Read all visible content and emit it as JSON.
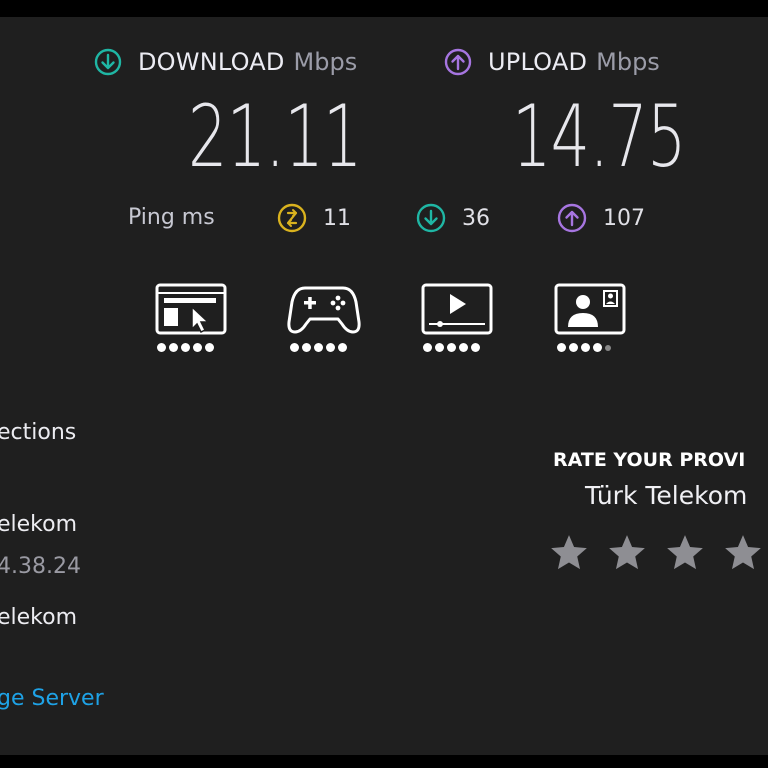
{
  "download": {
    "label": "DOWNLOAD",
    "unit": "Mbps",
    "value": "21.11",
    "color": "#1fb6a4"
  },
  "upload": {
    "label": "UPLOAD",
    "unit": "Mbps",
    "value": "14.75",
    "color": "#a675e0"
  },
  "ping": {
    "label": "Ping ms",
    "idle": {
      "value": "11",
      "color": "#d9b21e"
    },
    "down": {
      "value": "36",
      "color": "#1fb6a4"
    },
    "up": {
      "value": "107",
      "color": "#a675e0"
    }
  },
  "quality": [
    {
      "icon": "web-browsing-icon",
      "rating": 5
    },
    {
      "icon": "gaming-icon",
      "rating": 5
    },
    {
      "icon": "video-streaming-icon",
      "rating": 5
    },
    {
      "icon": "video-call-icon",
      "rating": 4
    }
  ],
  "connections": {
    "title": "ections",
    "provider_name": "elekom",
    "ip": "4.38.24",
    "server_name": "elekom",
    "change_server": "ge Server"
  },
  "rating": {
    "title": "RATE YOUR PROVI",
    "provider": "Türk Telekom",
    "star_count": 4,
    "star_color": "#8e8e93"
  }
}
